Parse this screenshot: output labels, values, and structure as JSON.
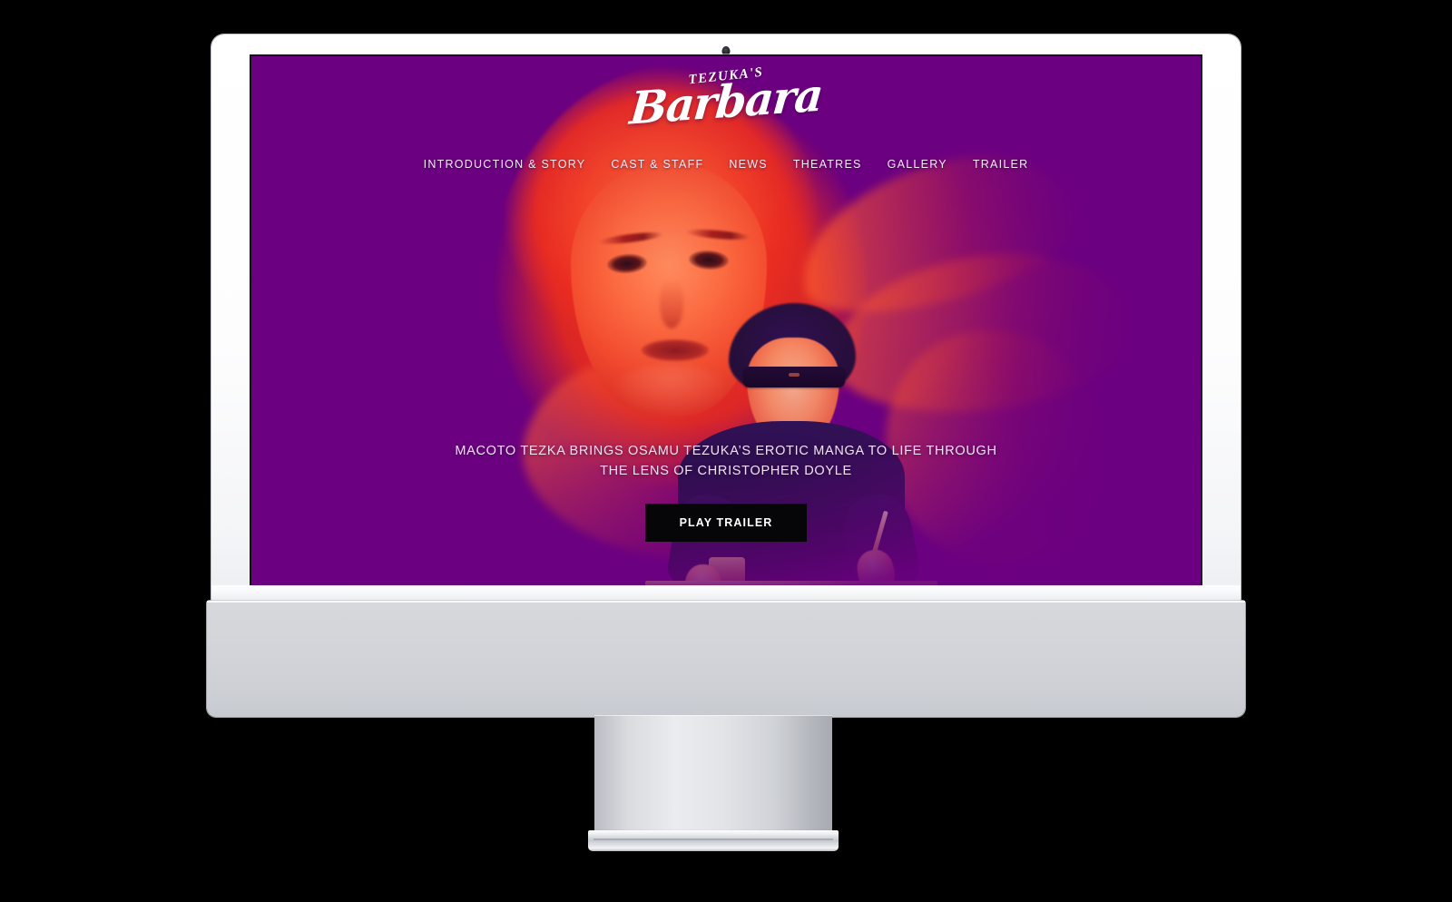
{
  "device": {
    "type": "all-in-one-desktop-computer",
    "bezel_color": "#FFFFFF",
    "body_color": "#D2D4D9",
    "stand_color": "#D9DBDF",
    "webcam_label": "webcam"
  },
  "site": {
    "background_color": "#6B0080",
    "accent_color": "#FF4A22",
    "logo": {
      "kicker": "TEZUKA'S",
      "wordmark": "Barbara"
    },
    "nav": {
      "items": [
        {
          "label": "INTRODUCTION & STORY",
          "name": "nav-introduction-story"
        },
        {
          "label": "CAST & STAFF",
          "name": "nav-cast-staff"
        },
        {
          "label": "NEWS",
          "name": "nav-news"
        },
        {
          "label": "THEATRES",
          "name": "nav-theatres"
        },
        {
          "label": "GALLERY",
          "name": "nav-gallery"
        },
        {
          "label": "TRAILER",
          "name": "nav-trailer"
        }
      ]
    },
    "hero": {
      "tagline": "MACOTO TEZKA BRINGS OSAMU TEZUKA’S EROTIC MANGA TO LIFE THROUGH THE LENS OF CHRISTOPHER DOYLE",
      "cta_label": "PLAY TRAILER",
      "cta_background": "#060608",
      "artwork_description": "Duotone red and purple photograph of a woman with flowing hair above a man wearing sunglasses drawing at a desk"
    }
  }
}
